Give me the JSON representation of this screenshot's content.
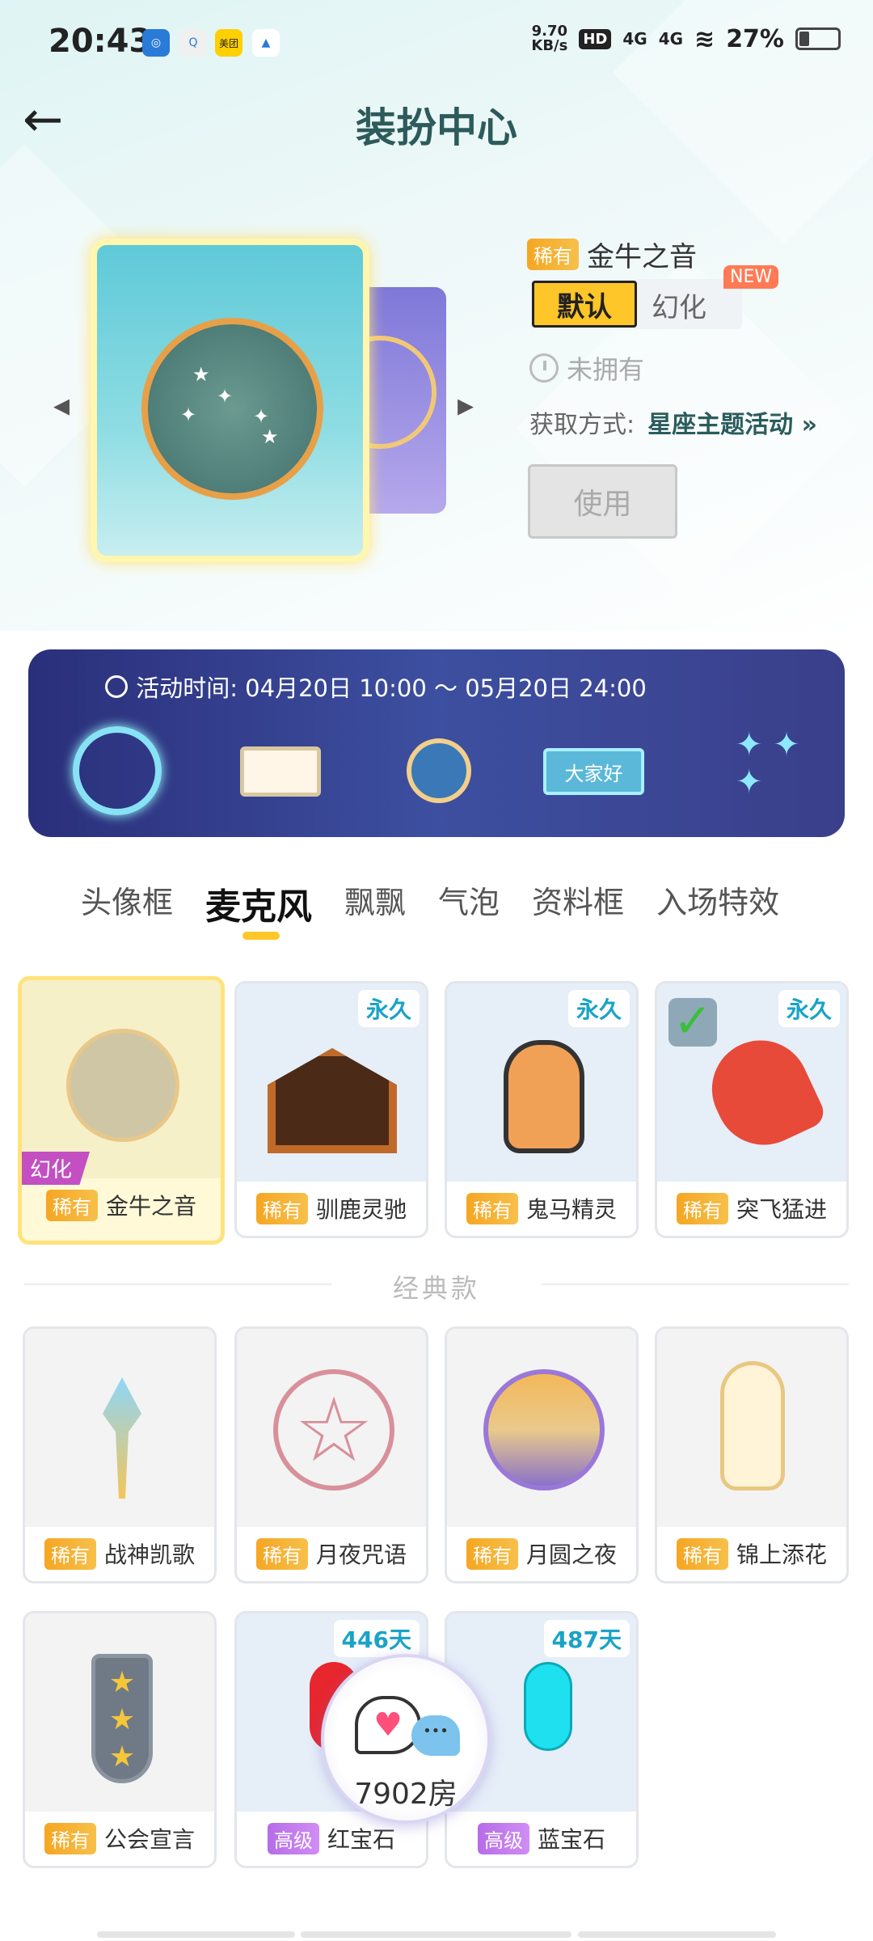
{
  "status_bar": {
    "time": "20:43",
    "speed": "9.70",
    "speed_unit": "KB/s",
    "hd": "HD",
    "net1": "4G",
    "net2": "4G",
    "battery": "27%",
    "battery_level": 0.27,
    "app_icons": [
      "browser-icon",
      "qq-icon",
      "meituan-icon",
      "app-icon"
    ],
    "meituan_label": "美团"
  },
  "header": {
    "title": "装扮中心"
  },
  "preview": {
    "rarity": "稀有",
    "name": "金牛之音",
    "default_label": "默认",
    "huanhua_label": "幻化",
    "new_badge": "NEW",
    "owned_status": "未拥有",
    "acquire_label": "获取方式:",
    "acquire_link": "星座主题活动",
    "acquire_arrow": "»",
    "use_button": "使用"
  },
  "banner": {
    "time_text": "活动时间: 04月20日 10:00 ～ 05月20日 24:00",
    "bubble_text": "大家好"
  },
  "tabs": [
    {
      "label": "头像框",
      "active": false
    },
    {
      "label": "麦克风",
      "active": true
    },
    {
      "label": "飘飘",
      "active": false
    },
    {
      "label": "气泡",
      "active": false
    },
    {
      "label": "资料框",
      "active": false
    },
    {
      "label": "入场特效",
      "active": false
    }
  ],
  "featured_items": [
    {
      "rarity": "稀有",
      "name": "金牛之音",
      "tag": "幻化",
      "selected": true
    },
    {
      "rarity": "稀有",
      "name": "驯鹿灵驰",
      "duration": "永久"
    },
    {
      "rarity": "稀有",
      "name": "鬼马精灵",
      "duration": "永久"
    },
    {
      "rarity": "稀有",
      "name": "突飞猛进",
      "duration": "永久",
      "checked": true
    }
  ],
  "classic_label": "经典款",
  "classic_items": [
    {
      "rarity": "稀有",
      "name": "战神凯歌"
    },
    {
      "rarity": "稀有",
      "name": "月夜咒语"
    },
    {
      "rarity": "稀有",
      "name": "月圆之夜"
    },
    {
      "rarity": "稀有",
      "name": "锦上添花"
    },
    {
      "rarity": "稀有",
      "name": "公会宣言"
    },
    {
      "rarity": "高级",
      "name": "红宝石",
      "duration": "446天"
    },
    {
      "rarity": "高级",
      "name": "蓝宝石",
      "duration": "487天"
    }
  ],
  "floating": {
    "room_text": "7902房"
  }
}
